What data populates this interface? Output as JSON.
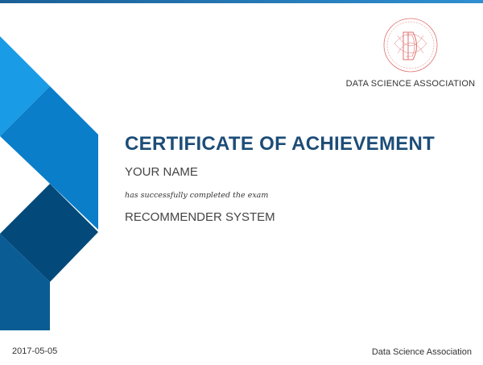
{
  "certificate": {
    "title": "CERTIFICATE OF ACHIEVEMENT",
    "recipient_name": "YOUR NAME",
    "completion_text": "has successfully completed the exam",
    "exam_name": "RECOMMENDER SYSTEM"
  },
  "logo": {
    "organization": "DATA SCIENCE ASSOCIATION",
    "icon": "dsa-seal-icon",
    "color": "#e0706f"
  },
  "footer": {
    "date": "2017-05-05",
    "issuer": "Data Science Association"
  },
  "colors": {
    "title": "#1d4d78",
    "accent_light": "#1a9be6",
    "accent_mid": "#0b77c2",
    "accent_dark": "#034a7a",
    "accent_bottom": "#0a5c95"
  }
}
